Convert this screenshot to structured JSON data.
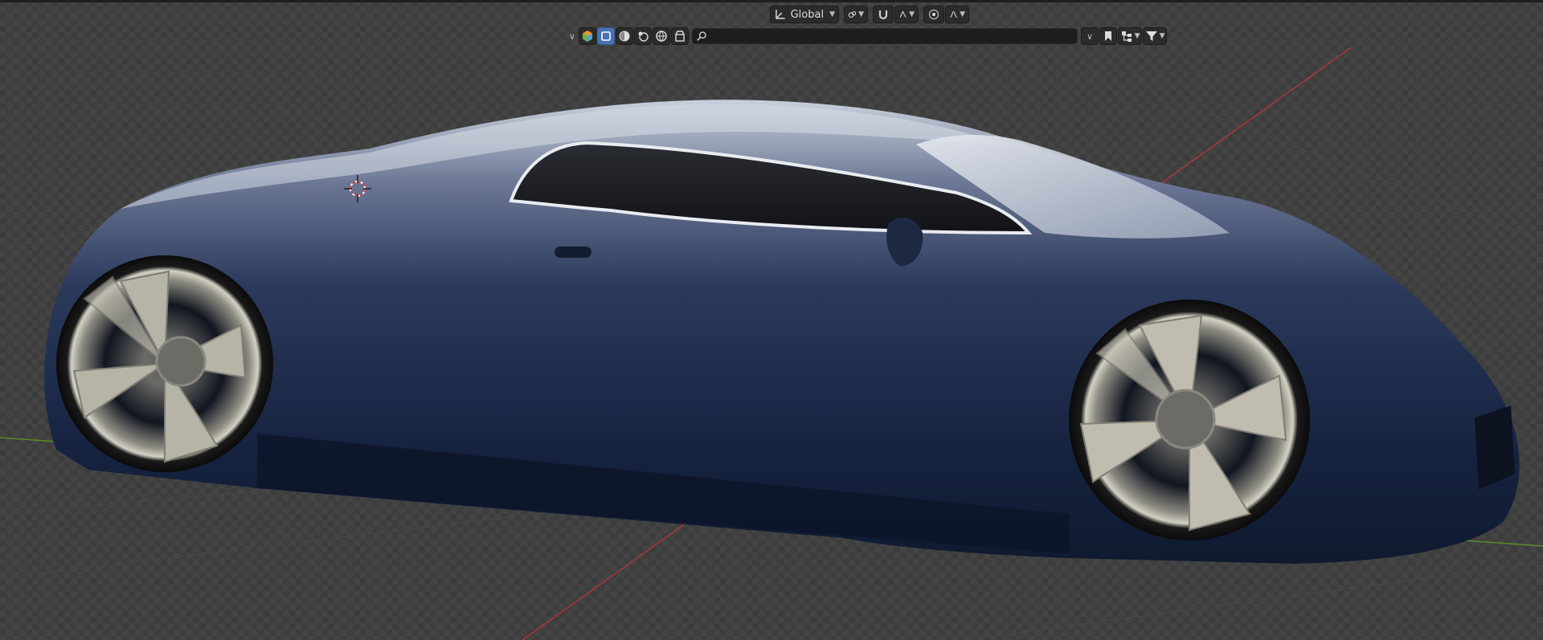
{
  "header": {
    "transform_orientation": {
      "icon": "transform-axes-icon",
      "value": "Global"
    },
    "pivot": {
      "icon": "pivot-point-icon"
    },
    "snapping": {
      "icon": "snap-magnet-icon"
    },
    "proportional": {
      "icon": "proportional-editing-icon"
    },
    "falloff": {
      "icon": "falloff-curve-icon"
    }
  },
  "outliner_filter": {
    "display_mode_icon": "display-mode-icon",
    "filter_icons": [
      "object-type-icon",
      "collection-icon",
      "shading-icon",
      "material-icon",
      "world-icon",
      "scene-icon"
    ],
    "search": {
      "placeholder": "",
      "value": ""
    },
    "right_icons": [
      "bookmark-icon",
      "hierarchy-icon",
      "filter-icon"
    ]
  },
  "scene": {
    "object": "sports car",
    "body_color": "#1c2a4a",
    "axis_x_color": "#b0353d",
    "axis_y_color": "#5a8a2a",
    "cursor_color": "#d84040"
  }
}
